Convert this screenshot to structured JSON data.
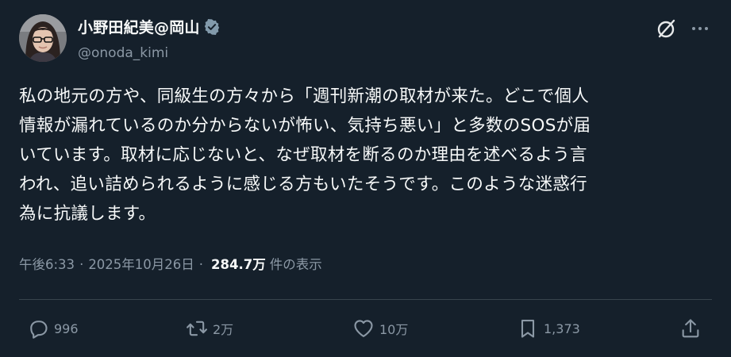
{
  "author": {
    "display_name": "小野田紀美@岡山",
    "handle": "@onoda_kimi",
    "verified": true
  },
  "tweet": {
    "text": "私の地元の方や、同級生の方々から「週刊新潮の取材が来た。どこで個人\n情報が漏れているのか分からないが怖い、気持ち悪い」と多数のSOSが届\nいています。取材に応じないと、なぜ取材を断るのか理由を述べるよう言\nわれ、追い詰められるように感じる方もいたそうです。このような迷惑行\n為に抗議します。"
  },
  "meta": {
    "time": "午後6:33",
    "separator": "·",
    "date": "2025年10月26日",
    "views": "284.7万",
    "views_label": "件の表示"
  },
  "actions": {
    "replies": "996",
    "reposts": "2万",
    "likes": "10万",
    "bookmarks": "1,373"
  },
  "icons": {
    "verified": "verified-badge-icon",
    "grok": "grok-icon",
    "more": "more-icon",
    "reply": "reply-icon",
    "repost": "repost-icon",
    "like": "heart-icon",
    "bookmark": "bookmark-icon",
    "share": "share-icon"
  },
  "colors": {
    "background": "#15202b",
    "text": "#f7f9f9",
    "secondary": "#8b98a5",
    "divider": "#38444d",
    "verified_badge": "#829aab"
  }
}
